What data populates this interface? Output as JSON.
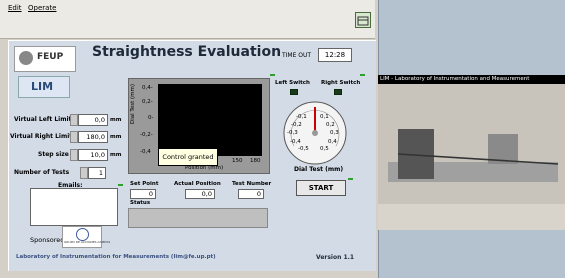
{
  "menu": {
    "edit": "Edit",
    "operate": "Operate"
  },
  "header": {
    "title": "Straightness Evaluation",
    "timeout_label": "TIME OUT",
    "timeout_value": "12:28"
  },
  "logos": {
    "feup": "FEUP",
    "lim": "LIM"
  },
  "graph": {
    "ylabel": "Dial Test (mm)",
    "xlabel": "Position (mm)",
    "yticks": [
      "0,4-",
      "0,2-",
      "0-",
      "-0,2-",
      "-0,4"
    ],
    "xticks": [
      "150",
      "180"
    ]
  },
  "tooltip": "Control granted",
  "switches": {
    "left": "Left Switch",
    "right": "Right Switch"
  },
  "dial": {
    "label": "Dial Test (mm)",
    "ticks": [
      "-0,1",
      "0,1",
      "-0,2",
      "0,2",
      "-0,3",
      "0,3",
      "-0,4",
      "0,4",
      "-0,5",
      "0,5"
    ]
  },
  "fields": [
    {
      "label": "Virtual Left Limit",
      "value": "0,0",
      "unit": "mm"
    },
    {
      "label": "Virtual Right Limit",
      "value": "180,0",
      "unit": "mm"
    },
    {
      "label": "Step size",
      "value": "10,0",
      "unit": "mm"
    },
    {
      "label": "Number of Tests",
      "value": "1",
      "unit": ""
    }
  ],
  "emails_label": "Emails:",
  "sponsor": {
    "label": "Sponsored",
    "logo_text": "GRUPO DE ACCIONES-CAMPOS"
  },
  "stats": {
    "set_point_label": "Set Point",
    "set_point_value": "0",
    "actual_position_label": "Actual Position",
    "actual_position_value": "0,0",
    "test_number_label": "Test Number",
    "test_number_value": "0"
  },
  "status_label": "Status",
  "start_label": "START",
  "footer": {
    "lab": "Laboratory of Instrumentation for Measurements (lim@fe.up.pt)",
    "version": "Version 1.1"
  },
  "video_title": "LIM - Laboratory of Instrumentation and Measurement",
  "colors": {
    "panel": "#d2dbe6",
    "led": "#1a3a1a",
    "title": "#1e2a3a"
  }
}
